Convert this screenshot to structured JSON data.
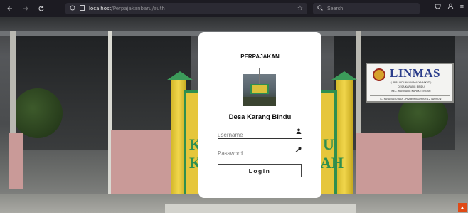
{
  "browser": {
    "url_host": "localhost",
    "url_path": "/Perpajakanbaru/auth",
    "search_placeholder": "Search"
  },
  "background": {
    "sign_title": "LINMAS",
    "sign_lines": [
      "( PERLINDUNGAN MASYARAKAT )",
      "DESA KARANG BINDU",
      "KEC. RAMBANG KAPAK TENGAH"
    ],
    "sign_footer": "JL. RAYA BATURAJA - PRABUMULIH KM 12 (DUSUN)",
    "gate_letters_left": [
      "K",
      "K"
    ],
    "gate_letters_right": [
      "U",
      "AH"
    ]
  },
  "login": {
    "title": "PERPAJAKAN",
    "village_name": "Desa Karang Bindu",
    "username_placeholder": "username",
    "password_placeholder": "Password",
    "login_label": "Login"
  },
  "icons": {
    "user": "user-icon",
    "key": "key-icon"
  },
  "colors": {
    "card_bg": "#ffffff",
    "gate_yellow": "#e6c63b",
    "gate_green": "#2f8f4f",
    "linmas_blue": "#2b3d8b",
    "toolbar_bg": "#1c1b22"
  }
}
